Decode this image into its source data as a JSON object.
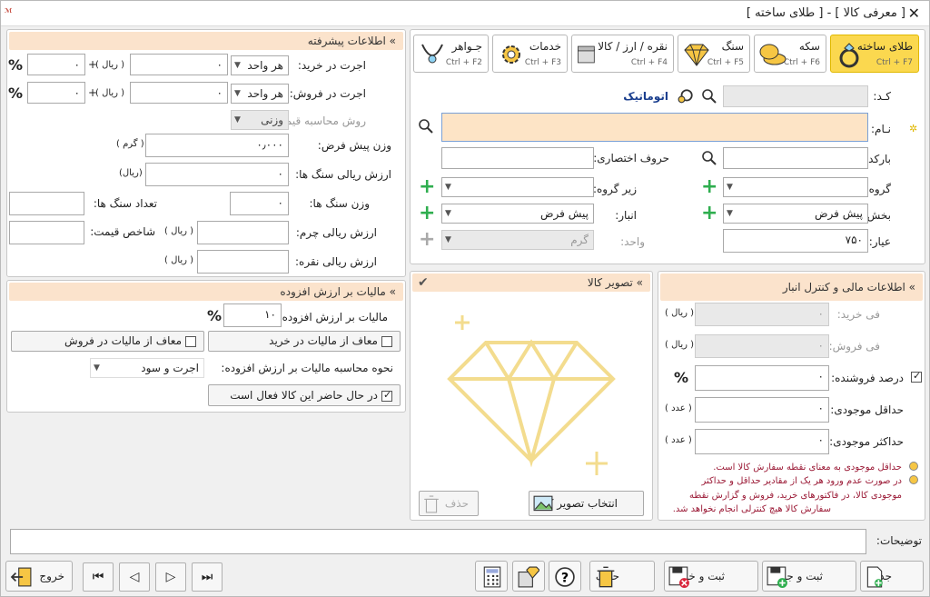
{
  "window": {
    "title": "[ معرفی کالا ] - [ طلای ساخته ]"
  },
  "tabs": [
    {
      "name": "طلای ساخته",
      "key": "Ctrl + F7"
    },
    {
      "name": "سکه",
      "key": "Ctrl + F6"
    },
    {
      "name": "سنگ",
      "key": "Ctrl + F5"
    },
    {
      "name": "نقره / ارز / کالا",
      "key": "Ctrl + F4"
    },
    {
      "name": "خدمات",
      "key": "Ctrl + F3"
    },
    {
      "name": "جـواهر",
      "key": "Ctrl + F2"
    }
  ],
  "main": {
    "code_label": "کـد:",
    "auto_label": "اتوماتیک",
    "name_label": "نـام:",
    "name_value": "",
    "barcode_label": "بارکد:",
    "abbr_label": "حروف اختصاری:",
    "group_label": "گروه:",
    "subgroup_label": "زیر گروه:",
    "section_label": "بخش:",
    "section_value": "پیش فرض",
    "store_label": "انبار:",
    "store_value": "پیش فرض",
    "purity_label": "عیار:",
    "purity_value": "۷۵۰",
    "unit_label": "واحد:",
    "unit_value": "گرم"
  },
  "advanced": {
    "header": "» اطلاعات پیشرفته",
    "buy_wage_label": "اجرت در خرید:",
    "buy_wage_select": "هر واحد",
    "buy_wage_value": "۰",
    "rial": "( ریال )",
    "plus_sign": "+",
    "buy_wage_pct": "۰",
    "sell_wage_label": "اجرت در فروش:",
    "sell_wage_select": "هر واحد",
    "sell_wage_value": "۰",
    "sell_wage_pct": "۰",
    "price_method_label": "روش محاسبه قیمت:",
    "price_method_value": "وزنی",
    "default_weight_label": "وزن پیش فرض:",
    "default_weight_value": "۰٫۰۰۰",
    "gram": "( گرم )",
    "stone_value_label": "ارزش ریالی سنگ ها:",
    "stone_value": "۰",
    "rial2": "(ریال)",
    "stone_weight_label": "وزن سنگ ها:",
    "stone_weight": "۰",
    "stone_count_label": "تعداد سنگ ها:",
    "stone_count": "",
    "leather_label": "ارزش ریالی چرم:",
    "leather_value": "",
    "price_index_label": "شاخص قیمت:",
    "price_index": "",
    "silver_label": "ارزش ریالی نقره:",
    "silver_value": ""
  },
  "vat": {
    "header": "» مالیات بر ارزش افزوده",
    "vat_label": "مالیات بر ارزش افزوده:",
    "vat_value": "۱۰",
    "exempt_buy": "معاف از مالیات در خرید",
    "exempt_sell": "معاف از مالیات در فروش",
    "calc_method_label": "نحوه محاسبه مالیات بر ارزش افزوده:",
    "calc_method_value": "اجرت و سود",
    "active_label": "در حال حاضر این کالا فعال است"
  },
  "image": {
    "header": "» تصویر کالا",
    "select_btn": "انتخاب تصویر کالا",
    "delete_btn": "حذف"
  },
  "finance": {
    "header": "» اطلاعات مالی و کنترل انبار",
    "buy_price_label": "فی خرید:",
    "buy_price": "۰",
    "sell_price_label": "فی فروش:",
    "sell_price": "۰",
    "seller_pct_label": "درصد فروشنده:",
    "seller_pct": "۰",
    "min_stock_label": "حداقل موجودی:",
    "min_stock": "۰",
    "count_unit": "( عدد )",
    "max_stock_label": "حداکثر موجودی:",
    "max_stock": "۰",
    "note1": "حداقل موجودی به معنای نقطه سفارش کالا است.",
    "note2": "در صورت عدم ورود هر یک از مقادیر حداقل و حداکثر",
    "note3": "موجودی کالا، در فاکتورهای خرید، فروش و گزارش نقطه",
    "note4": "سفارش کالا هیچ کنترلی انجام نخواهد شد."
  },
  "desc_label": "توضیحات:",
  "footer": {
    "new": "جدید",
    "save_new": "ثبت و جدید",
    "save_exit": "ثبت و خروج",
    "delete": "حذف",
    "exit": "خروج"
  },
  "colors": {
    "accent": "#fbd84f",
    "header_bg": "#fbe3cc",
    "name_bg": "#fde4c6",
    "plus": "#2fae4f",
    "note": "#9b1a36"
  }
}
